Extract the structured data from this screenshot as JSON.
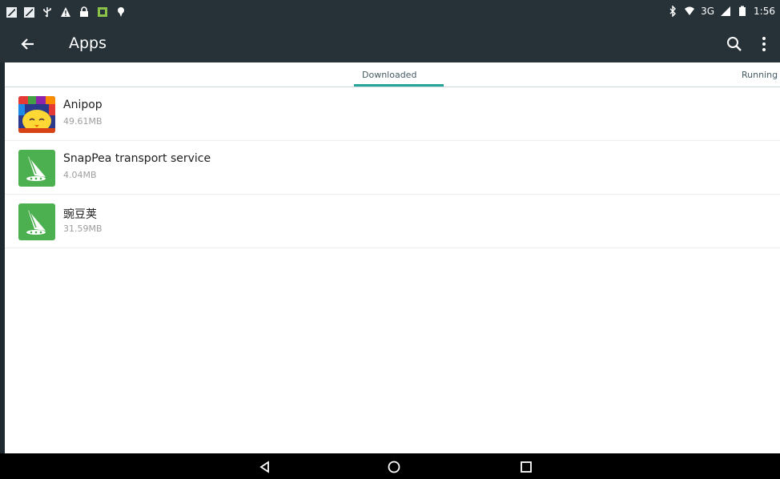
{
  "status_bar": {
    "network": "3G",
    "time": "1:56"
  },
  "app_bar": {
    "title": "Apps",
    "icons": [
      "back-arrow-icon",
      "search-icon",
      "more-vert-icon"
    ]
  },
  "tabs": [
    {
      "label": "Downloaded",
      "selected": true
    },
    {
      "label": "Running",
      "selected": false
    }
  ],
  "apps": [
    {
      "name": "Anipop",
      "size": "49.61MB",
      "icon": "anipop-app-icon"
    },
    {
      "name": "SnapPea transport service",
      "size": "4.04MB",
      "icon": "snappea-app-icon"
    },
    {
      "name": "豌豆荚",
      "size": "31.59MB",
      "icon": "snappea-app-icon"
    }
  ],
  "colors": {
    "app_bar": "#263238",
    "tab_indicator": "#26a69a",
    "snappea_green": "#4caf50",
    "nav_bar": "#000000"
  }
}
